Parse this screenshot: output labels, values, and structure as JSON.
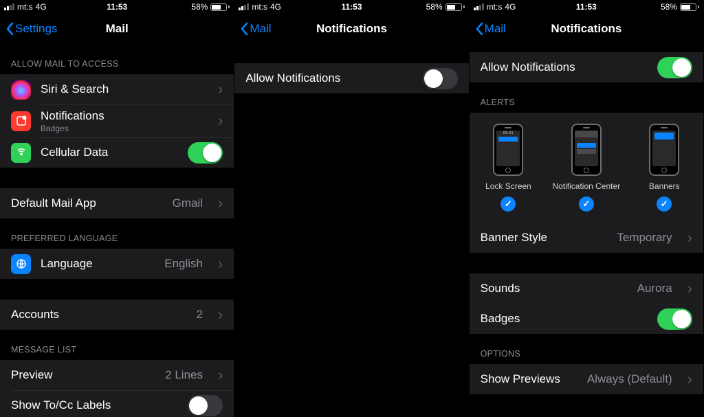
{
  "status": {
    "carrier": "mt:s",
    "network": "4G",
    "time": "11:53",
    "battery_pct": "58%",
    "battery_fill": 58
  },
  "s1": {
    "back": "Settings",
    "title": "Mail",
    "header_access": "ALLOW MAIL TO ACCESS",
    "siri": "Siri & Search",
    "notifications": "Notifications",
    "notifications_sub": "Badges",
    "cellular": "Cellular Data",
    "default_mail": "Default Mail App",
    "default_mail_val": "Gmail",
    "header_lang": "PREFERRED LANGUAGE",
    "language": "Language",
    "language_val": "English",
    "accounts": "Accounts",
    "accounts_val": "2",
    "header_msg": "MESSAGE LIST",
    "preview": "Preview",
    "preview_val": "2 Lines",
    "show_tocc": "Show To/Cc Labels"
  },
  "s2": {
    "back": "Mail",
    "title": "Notifications",
    "allow": "Allow Notifications"
  },
  "s3": {
    "back": "Mail",
    "title": "Notifications",
    "allow": "Allow Notifications",
    "header_alerts": "ALERTS",
    "lock_time": "09:41",
    "lock_label": "Lock Screen",
    "center_label": "Notification Center",
    "banner_label": "Banners",
    "banner_style": "Banner Style",
    "banner_style_val": "Temporary",
    "sounds": "Sounds",
    "sounds_val": "Aurora",
    "badges": "Badges",
    "header_options": "OPTIONS",
    "show_previews": "Show Previews",
    "show_previews_val": "Always (Default)"
  }
}
